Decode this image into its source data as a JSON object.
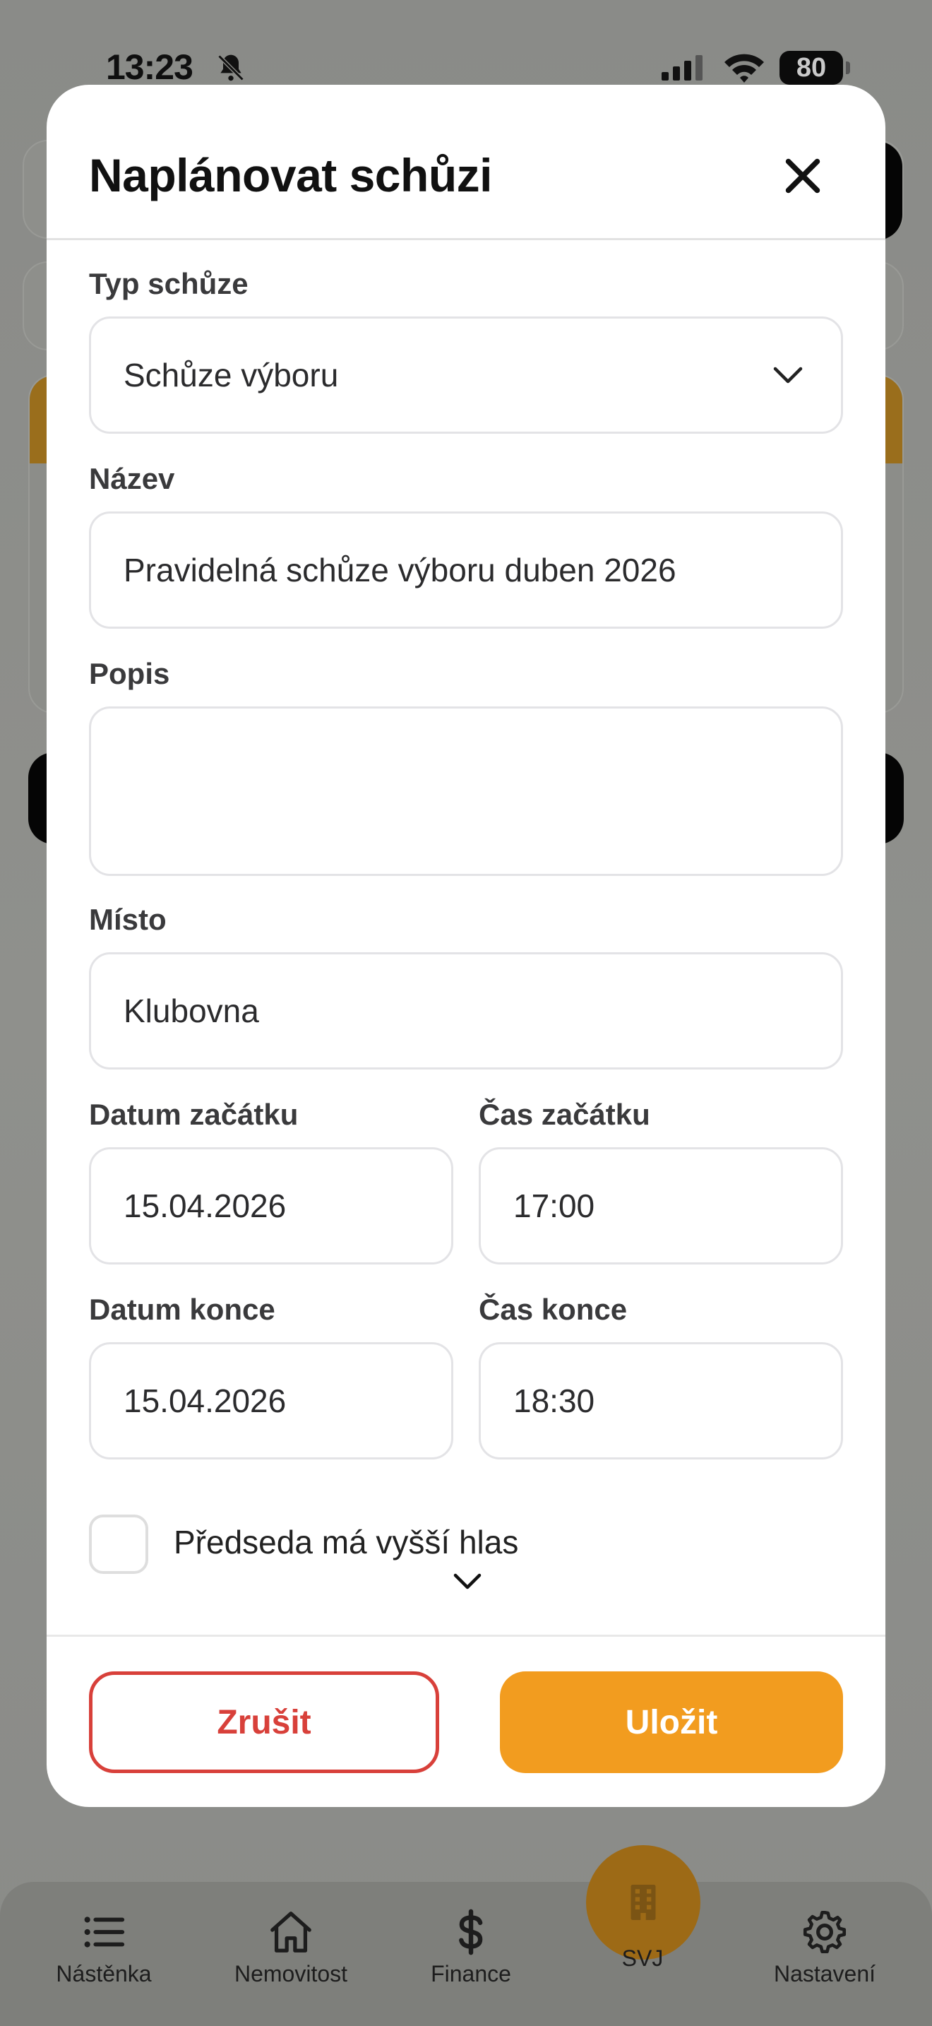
{
  "status_bar": {
    "time": "13:23",
    "battery": "80"
  },
  "modal": {
    "title": "Naplánovat schůzi",
    "fields": {
      "meeting_type": {
        "label": "Typ schůze",
        "value": "Schůze výboru"
      },
      "name": {
        "label": "Název",
        "value": "Pravidelná schůze výboru duben 2026"
      },
      "description": {
        "label": "Popis",
        "value": ""
      },
      "place": {
        "label": "Místo",
        "value": "Klubovna"
      },
      "start_date": {
        "label": "Datum začátku",
        "value": "15.04.2026"
      },
      "start_time": {
        "label": "Čas začátku",
        "value": "17:00"
      },
      "end_date": {
        "label": "Datum konce",
        "value": "15.04.2026"
      },
      "end_time": {
        "label": "Čas konce",
        "value": "18:30"
      }
    },
    "checkbox": {
      "label": "Předseda má vyšší hlas",
      "checked": false
    },
    "buttons": {
      "cancel": "Zrušit",
      "save": "Uložit"
    },
    "colors": {
      "accent": "#f29c1f",
      "danger": "#d8403a"
    }
  },
  "tab_bar": {
    "items": [
      {
        "label": "Nástěnka",
        "icon": "list-icon"
      },
      {
        "label": "Nemovitost",
        "icon": "house-icon"
      },
      {
        "label": "Finance",
        "icon": "dollar-icon"
      },
      {
        "label": "SVJ",
        "icon": "building-icon"
      },
      {
        "label": "Nastavení",
        "icon": "gear-icon"
      }
    ]
  }
}
